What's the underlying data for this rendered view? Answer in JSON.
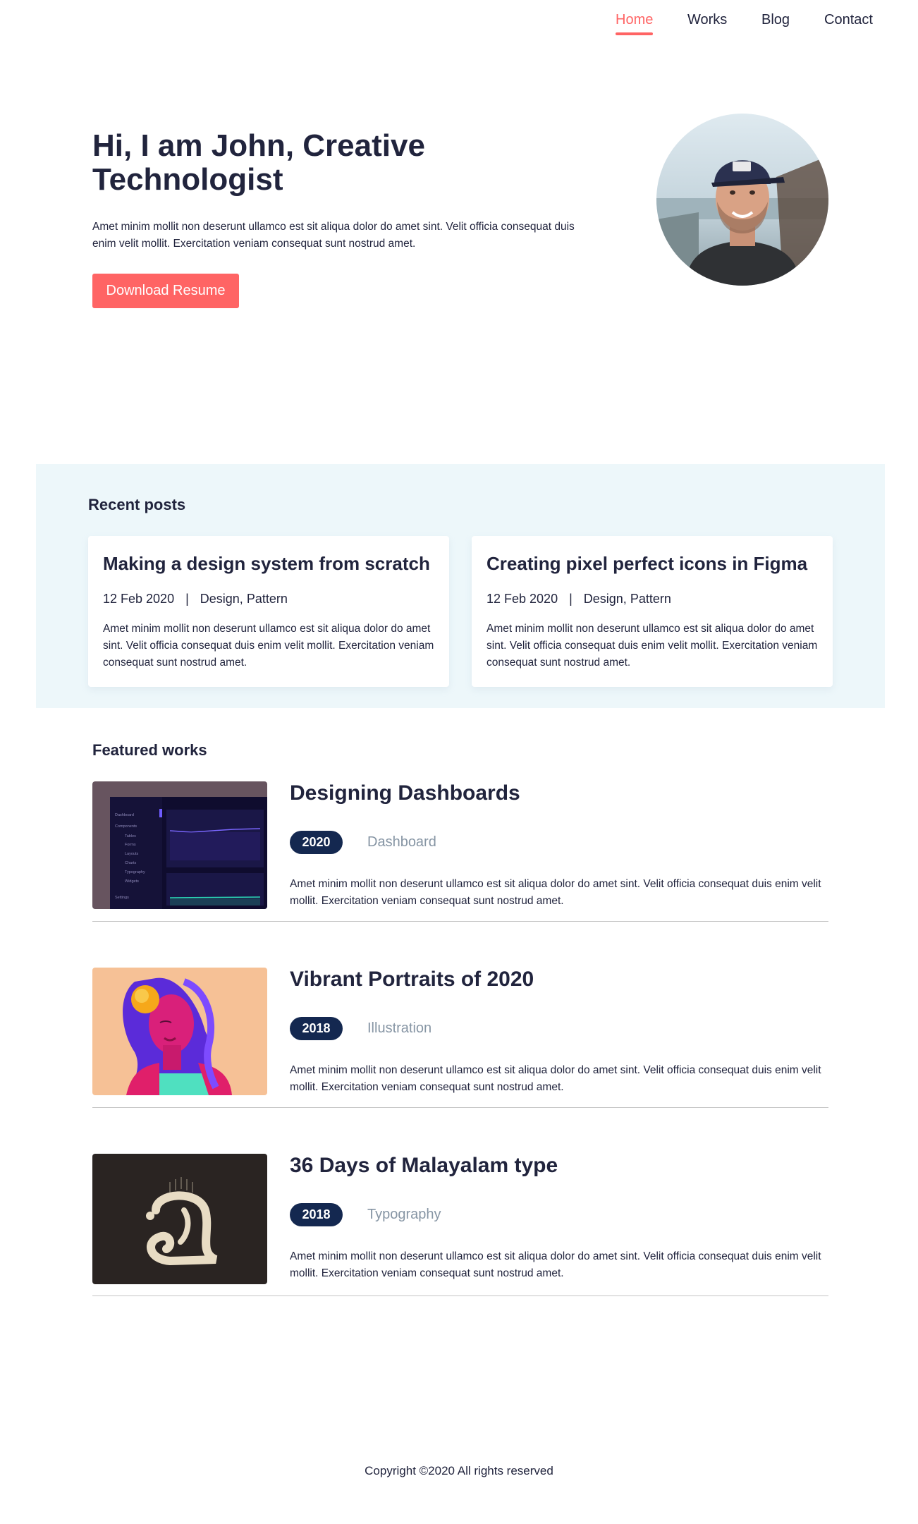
{
  "nav": {
    "items": [
      {
        "label": "Home",
        "active": true
      },
      {
        "label": "Works",
        "active": false
      },
      {
        "label": "Blog",
        "active": false
      },
      {
        "label": "Contact",
        "active": false
      }
    ]
  },
  "hero": {
    "title": "Hi, I am John, Creative Technologist",
    "text": "Amet minim mollit non deserunt ullamco est sit aliqua dolor do amet sint. Velit officia consequat duis enim velit mollit. Exercitation veniam consequat sunt nostrud amet.",
    "button": "Download Resume"
  },
  "recent": {
    "title": "Recent posts",
    "posts": [
      {
        "title": "Making a design system from scratch",
        "date": "12 Feb 2020",
        "separator": "|",
        "tags": "Design, Pattern",
        "text": "Amet minim mollit non deserunt ullamco est sit aliqua dolor do amet sint. Velit officia consequat duis enim velit mollit. Exercitation veniam consequat sunt nostrud amet."
      },
      {
        "title": "Creating pixel perfect icons in Figma",
        "date": "12 Feb 2020",
        "separator": "|",
        "tags": "Design, Pattern",
        "text": "Amet minim mollit non deserunt ullamco est sit aliqua dolor do amet sint. Velit officia consequat duis enim velit mollit. Exercitation veniam consequat sunt nostrud amet."
      }
    ]
  },
  "featured": {
    "title": "Featured works",
    "works": [
      {
        "title": "Designing Dashboards",
        "year": "2020",
        "category": "Dashboard",
        "text": "Amet minim mollit non deserunt ullamco est sit aliqua dolor do amet sint. Velit officia consequat duis enim velit mollit. Exercitation veniam consequat sunt nostrud amet."
      },
      {
        "title": "Vibrant Portraits of 2020",
        "year": "2018",
        "category": "Illustration",
        "text": "Amet minim mollit non deserunt ullamco est sit aliqua dolor do amet sint. Velit officia consequat duis enim velit mollit. Exercitation veniam consequat sunt nostrud amet."
      },
      {
        "title": "36 Days of Malayalam type",
        "year": "2018",
        "category": "Typography",
        "text": "Amet minim mollit non deserunt ullamco est sit aliqua dolor do amet sint. Velit officia consequat duis enim velit mollit. Exercitation veniam consequat sunt nostrud amet."
      }
    ]
  },
  "thumb_dashboard": {
    "sidebar_items": [
      "Dashboard",
      "Components",
      "Tables",
      "Forms",
      "Layouts",
      "Charts",
      "Typography",
      "Widgets",
      "Settings"
    ]
  },
  "footer": {
    "copyright": "Copyright ©2020 All rights reserved"
  },
  "colors": {
    "accent": "#FF6464",
    "dark": "#21243D",
    "badge": "#142850",
    "muted": "#8695A4",
    "section_bg": "#EDF7FA"
  }
}
